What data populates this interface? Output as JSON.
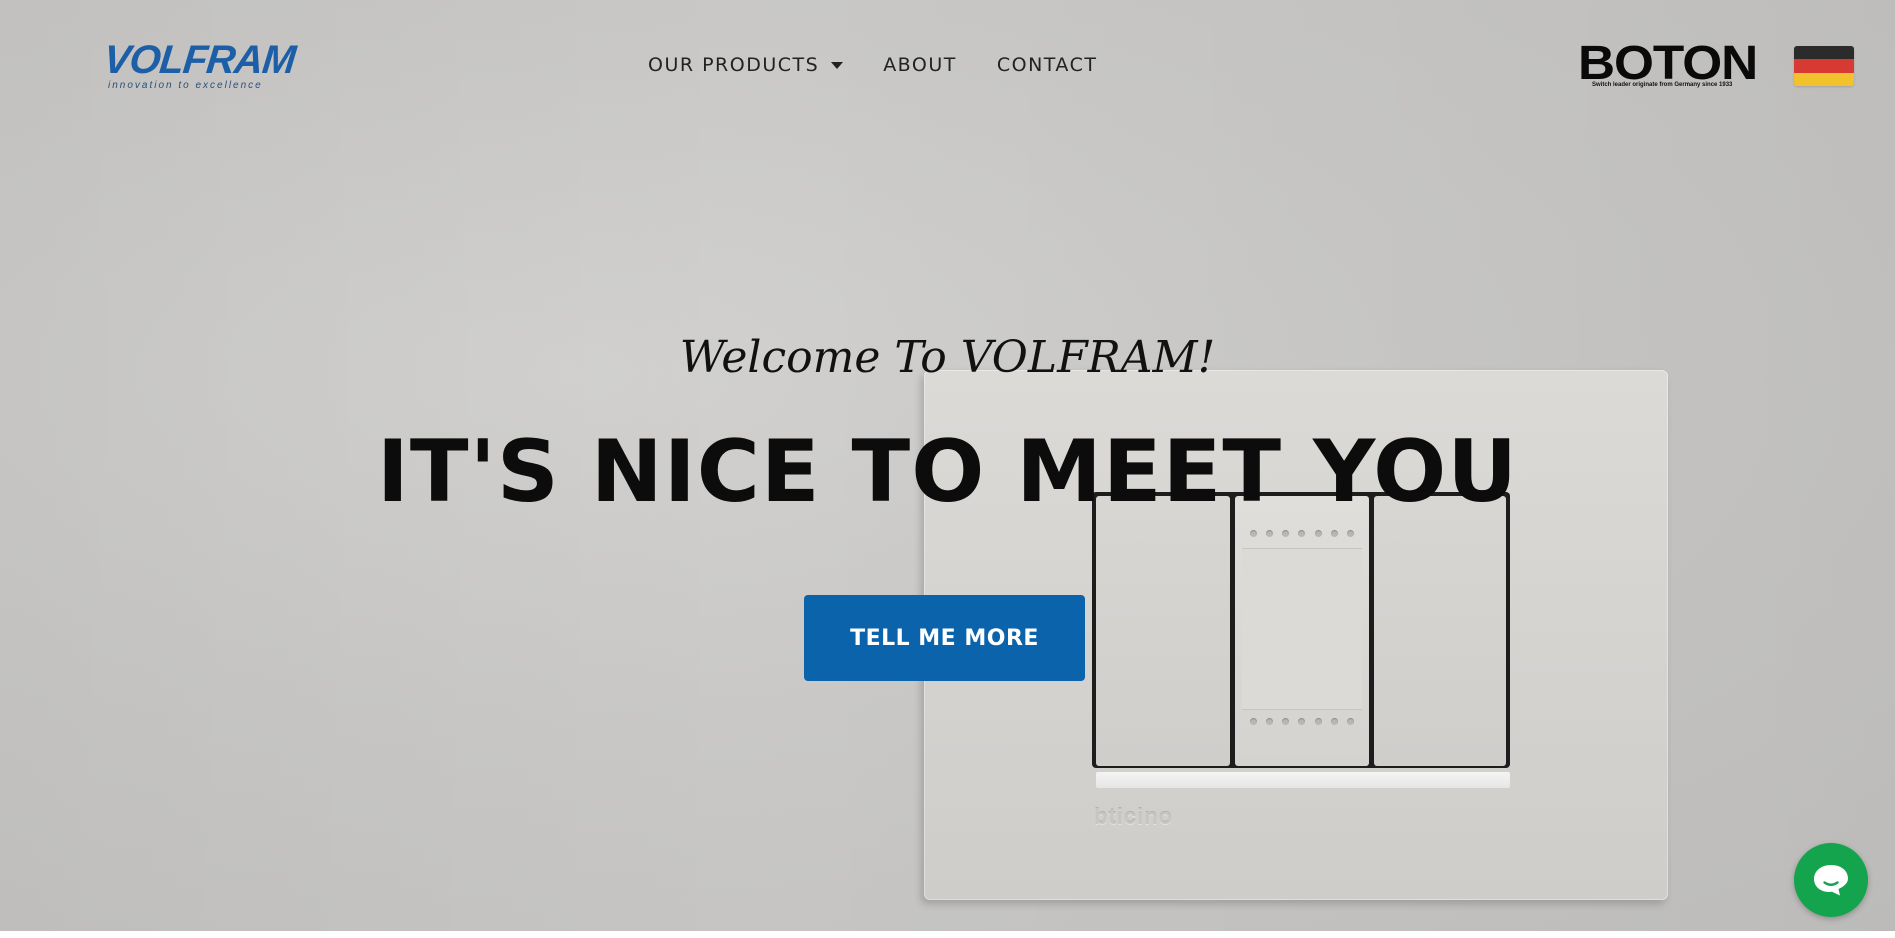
{
  "brand": {
    "name": "VOLFRAM",
    "tagline": "innovation to excellence",
    "color": "#1d5fa6"
  },
  "nav": {
    "items": [
      {
        "label": "OUR PRODUCTS",
        "dropdown": true
      },
      {
        "label": "ABOUT",
        "dropdown": false
      },
      {
        "label": "CONTACT",
        "dropdown": false
      }
    ]
  },
  "partner": {
    "name": "BOTON",
    "tagline": "Switch leader originate from Germany since 1933",
    "flag_colors": [
      "#2b2b2b",
      "#d63a33",
      "#f2c12e"
    ]
  },
  "hero": {
    "subheading": "Welcome To VOLFRAM!",
    "heading": "IT'S NICE TO MEET YOU",
    "cta_label": "TELL ME MORE",
    "cta_color": "#0b63ab",
    "plate_brand": "bticino"
  },
  "chat": {
    "icon": "chat-bubble-icon",
    "color": "#14a44d"
  }
}
